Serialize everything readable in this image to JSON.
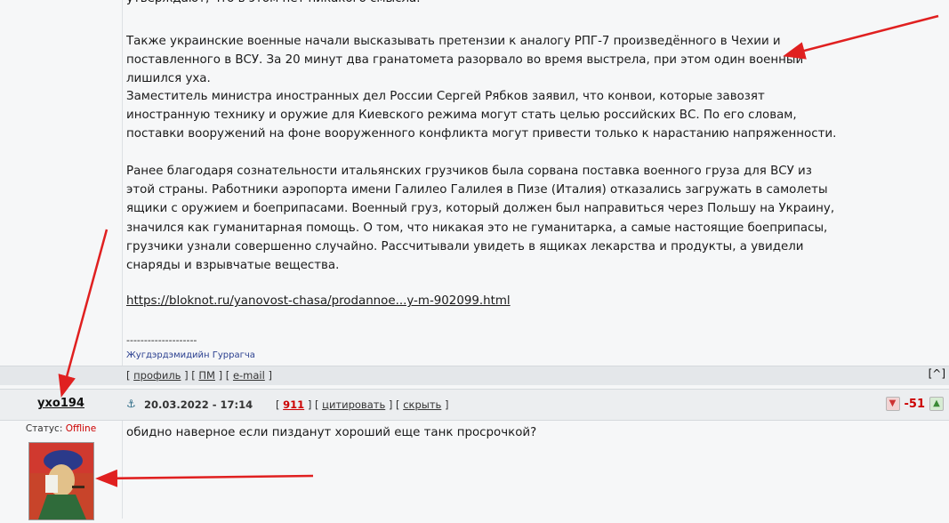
{
  "post": {
    "clipped_line": "утверждают, что в этом нет никакого смысла.",
    "p1": "Также украинские военные начали высказывать претензии к аналогу РПГ-7 произведённого в Чехии и поставленного в ВСУ. За 20 минут два гранатомета разорвало во время выстрела, при этом один военный лишился уха.",
    "p2": "Заместитель министра иностранных дел России Сергей Рябков заявил, что конвои, которые завозят иностранную технику и оружие для Киевского режима могут стать целью российских ВС. По его словам, поставки вооружений на фоне вооруженного конфликта могут привести только к нарастанию напряженности.",
    "p3": "Ранее благодаря сознательности итальянских грузчиков была сорвана поставка военного груза для ВСУ из этой страны. Работники аэропорта имени Галилео Галилея в Пизе (Италия) отказались загружать в самолеты ящики с оружием и боеприпасами. Военный груз, который должен был направиться через Польшу на Украину, значился как гуманитарная помощь. О том, что никакая это не гуманитарка, а самые настоящие боеприпасы, грузчики узнали совершенно случайно. Рассчитывали увидеть в ящиках лекарства и продукты, а увидели снаряды и взрывчатые вещества.",
    "link": "https://bloknot.ru/yanovost-chasa/prodannoe...y-m-902099.html",
    "sig_separator": "--------------------",
    "sig_name": "Жугдэрдэмидийн Гуррагча"
  },
  "author_bar": {
    "open": "[",
    "profile": "профиль",
    "sep1": "] [",
    "pm": "ПМ",
    "sep2": "] [",
    "email": "e-mail",
    "close": "]",
    "top_button": "[^]"
  },
  "reply": {
    "author": "yxo194",
    "anchor_icon": "⚓",
    "date": "20.03.2022 - 17:14",
    "open": "[",
    "post_number": "911",
    "sep1": "] [",
    "quote": "цитировать",
    "sep2": "] [",
    "hide": "скрыть",
    "close": "]",
    "status_label": "Статус:",
    "status_value": "Offline",
    "score": "-51",
    "text": "обидно наверное если пизданут хороший еще танк просрочкой?"
  },
  "icons": {
    "thumb_down": "thumb-down-icon",
    "thumb_up": "thumb-up-icon",
    "anchor": "anchor-icon"
  },
  "colors": {
    "accent_red": "#cc0000",
    "arrow_red": "#e02020"
  }
}
